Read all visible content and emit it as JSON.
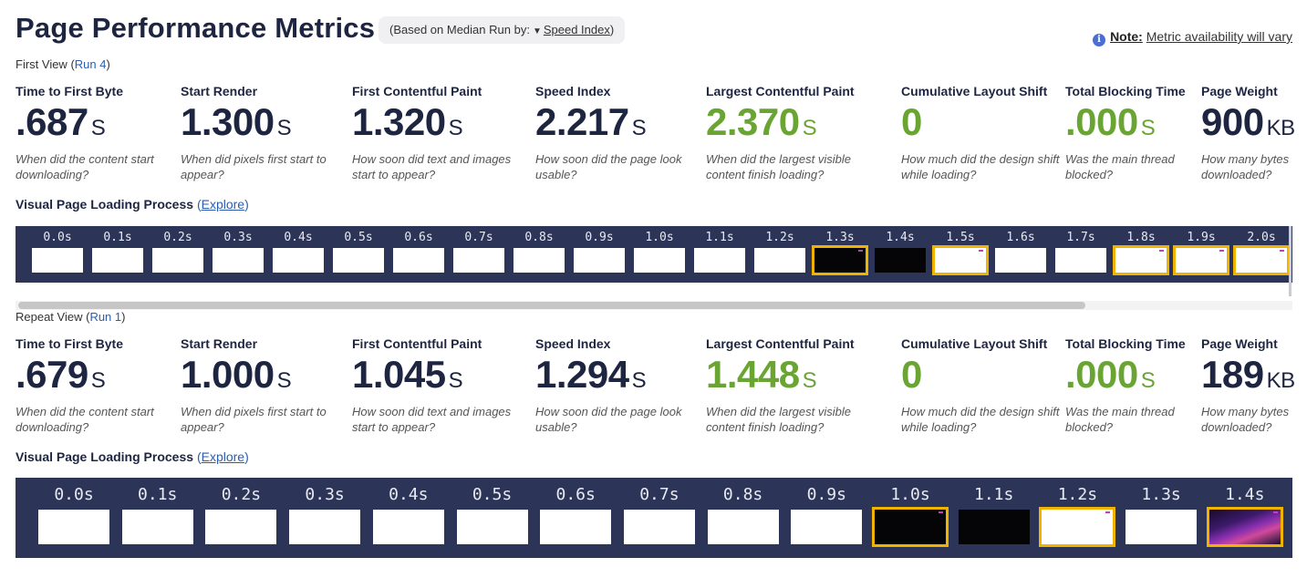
{
  "header": {
    "title": "Page Performance Metrics",
    "median_prefix": "(Based on Median Run by:",
    "median_selected": "Speed Index",
    "median_suffix": ")",
    "note_label": "Note:",
    "note_text": "Metric availability will vary"
  },
  "first_view": {
    "label": "First View",
    "run_link": "Run 4",
    "metrics": [
      {
        "title": "Time to First Byte",
        "value": ".687",
        "unit": "S",
        "desc": "When did the content start downloading?",
        "color": "#1e2541"
      },
      {
        "title": "Start Render",
        "value": "1.300",
        "unit": "S",
        "desc": "When did pixels first start to appear?",
        "color": "#1e2541"
      },
      {
        "title": "First Contentful Paint",
        "value": "1.320",
        "unit": "S",
        "desc": "How soon did text and images start to appear?",
        "color": "#1e2541"
      },
      {
        "title": "Speed Index",
        "value": "2.217",
        "unit": "S",
        "desc": "How soon did the page look usable?",
        "color": "#1e2541"
      },
      {
        "title": "Largest Contentful Paint",
        "value": "2.370",
        "unit": "S",
        "desc": "When did the largest visible content finish loading?",
        "color": "#6aa534"
      },
      {
        "title": "Cumulative Layout Shift",
        "value": "0",
        "unit": "",
        "desc": "How much did the design shift while loading?",
        "color": "#6aa534"
      },
      {
        "title": "Total Blocking Time",
        "value": ".000",
        "unit": "S",
        "desc": "Was the main thread blocked?",
        "color": "#6aa534"
      },
      {
        "title": "Page Weight",
        "value": "900",
        "unit": "KB",
        "desc": "How many bytes downloaded?",
        "color": "#1e2541"
      }
    ],
    "vplp_label": "Visual Page Loading Process",
    "explore_label": "Explore",
    "frames": [
      {
        "time": "0.0s",
        "state": "white",
        "hl": false
      },
      {
        "time": "0.1s",
        "state": "white",
        "hl": false
      },
      {
        "time": "0.2s",
        "state": "white",
        "hl": false
      },
      {
        "time": "0.3s",
        "state": "white",
        "hl": false
      },
      {
        "time": "0.4s",
        "state": "white",
        "hl": false
      },
      {
        "time": "0.5s",
        "state": "white",
        "hl": false
      },
      {
        "time": "0.6s",
        "state": "white",
        "hl": false
      },
      {
        "time": "0.7s",
        "state": "white",
        "hl": false
      },
      {
        "time": "0.8s",
        "state": "white",
        "hl": false
      },
      {
        "time": "0.9s",
        "state": "white",
        "hl": false
      },
      {
        "time": "1.0s",
        "state": "white",
        "hl": false
      },
      {
        "time": "1.1s",
        "state": "white",
        "hl": false
      },
      {
        "time": "1.2s",
        "state": "white",
        "hl": false
      },
      {
        "time": "1.3s",
        "state": "dark",
        "hl": true
      },
      {
        "time": "1.4s",
        "state": "dark",
        "hl": false
      },
      {
        "time": "1.5s",
        "state": "white",
        "hl": true
      },
      {
        "time": "1.6s",
        "state": "white",
        "hl": false
      },
      {
        "time": "1.7s",
        "state": "white",
        "hl": false
      },
      {
        "time": "1.8s",
        "state": "white",
        "hl": true
      },
      {
        "time": "1.9s",
        "state": "white",
        "hl": true
      },
      {
        "time": "2.0s",
        "state": "white",
        "hl": true
      }
    ]
  },
  "repeat_view": {
    "label": "Repeat View",
    "run_link": "Run 1",
    "metrics": [
      {
        "title": "Time to First Byte",
        "value": ".679",
        "unit": "S",
        "desc": "When did the content start downloading?",
        "color": "#1e2541"
      },
      {
        "title": "Start Render",
        "value": "1.000",
        "unit": "S",
        "desc": "When did pixels first start to appear?",
        "color": "#1e2541"
      },
      {
        "title": "First Contentful Paint",
        "value": "1.045",
        "unit": "S",
        "desc": "How soon did text and images start to appear?",
        "color": "#1e2541"
      },
      {
        "title": "Speed Index",
        "value": "1.294",
        "unit": "S",
        "desc": "How soon did the page look usable?",
        "color": "#1e2541"
      },
      {
        "title": "Largest Contentful Paint",
        "value": "1.448",
        "unit": "S",
        "desc": "When did the largest visible content finish loading?",
        "color": "#6aa534"
      },
      {
        "title": "Cumulative Layout Shift",
        "value": "0",
        "unit": "",
        "desc": "How much did the design shift while loading?",
        "color": "#6aa534"
      },
      {
        "title": "Total Blocking Time",
        "value": ".000",
        "unit": "S",
        "desc": "Was the main thread blocked?",
        "color": "#6aa534"
      },
      {
        "title": "Page Weight",
        "value": "189",
        "unit": "KB",
        "desc": "How many bytes downloaded?",
        "color": "#1e2541"
      }
    ],
    "vplp_label": "Visual Page Loading Process",
    "explore_label": "Explore",
    "frames": [
      {
        "time": "0.0s",
        "state": "white",
        "hl": false
      },
      {
        "time": "0.1s",
        "state": "white",
        "hl": false
      },
      {
        "time": "0.2s",
        "state": "white",
        "hl": false
      },
      {
        "time": "0.3s",
        "state": "white",
        "hl": false
      },
      {
        "time": "0.4s",
        "state": "white",
        "hl": false
      },
      {
        "time": "0.5s",
        "state": "white",
        "hl": false
      },
      {
        "time": "0.6s",
        "state": "white",
        "hl": false
      },
      {
        "time": "0.7s",
        "state": "white",
        "hl": false
      },
      {
        "time": "0.8s",
        "state": "white",
        "hl": false
      },
      {
        "time": "0.9s",
        "state": "white",
        "hl": false
      },
      {
        "time": "1.0s",
        "state": "dark",
        "hl": true
      },
      {
        "time": "1.1s",
        "state": "dark",
        "hl": false
      },
      {
        "time": "1.2s",
        "state": "white",
        "hl": true
      },
      {
        "time": "1.3s",
        "state": "white",
        "hl": false
      },
      {
        "time": "1.4s",
        "state": "gradient",
        "hl": true
      }
    ]
  }
}
